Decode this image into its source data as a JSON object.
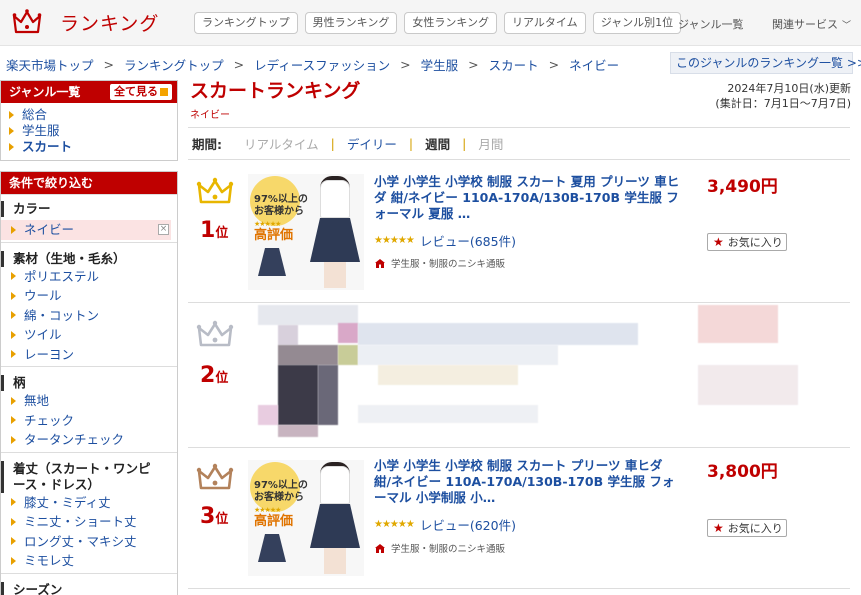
{
  "header": {
    "logo_text": "ランキング",
    "tabs": [
      "ランキングトップ",
      "男性ランキング",
      "女性ランキング",
      "リアルタイム",
      "ジャンル別1位"
    ],
    "genre_list": "ジャンル一覧",
    "related": "関連サービス"
  },
  "breadcrumb": [
    "楽天市場トップ",
    "ランキングトップ",
    "レディースファッション",
    "学生服",
    "スカート",
    "ネイビー"
  ],
  "genre_ranking_link": "このジャンルのランキング一覧 >>",
  "sidebar": {
    "genre_head": "ジャンル一覧",
    "show_all": "全て見る",
    "genres": [
      "総合",
      "学生服",
      "スカート"
    ],
    "filter_head": "条件で絞り込む",
    "groups": [
      {
        "title": "カラー",
        "items": [
          "ネイビー"
        ]
      },
      {
        "title": "素材（生地・毛糸）",
        "items": [
          "ポリエステル",
          "ウール",
          "綿・コットン",
          "ツイル",
          "レーヨン"
        ]
      },
      {
        "title": "柄",
        "items": [
          "無地",
          "チェック",
          "タータンチェック"
        ]
      },
      {
        "title": "着丈（スカート・ワンピース・ドレス）",
        "items": [
          "膝丈・ミディ丈",
          "ミニ丈・ショート丈",
          "ロング丈・マキシ丈",
          "ミモレ丈"
        ]
      },
      {
        "title": "シーズン",
        "items": []
      }
    ]
  },
  "main": {
    "title": "スカートランキング",
    "subtitle": "ネイビー",
    "updated": "2024年7月10日(水)更新",
    "period_range": "(集計日：7月1日～7月7日)",
    "period_label": "期間:",
    "periods": [
      "リアルタイム",
      "デイリー",
      "週間",
      "月間"
    ]
  },
  "items": [
    {
      "rank": "1",
      "rank_suffix": "位",
      "title": "小学 小学生 小学校 制服 スカート 夏用 プリーツ 車ヒダ 紺/ネイビー 110A-170A/130B-170B 学生服 フォーマル 夏服 …",
      "rating_text": "レビュー(685件)",
      "shop": "学生服・制服のニシキ通販",
      "price": "3,490円",
      "fav": "お気に入り",
      "promo_line1": "97%以上の",
      "promo_line2": "お客様から",
      "promo_line3": "高評価"
    },
    {
      "rank": "2",
      "rank_suffix": "位"
    },
    {
      "rank": "3",
      "rank_suffix": "位",
      "title": "小学 小学生 小学校 制服 スカート プリーツ 車ヒダ 紺/ネイビー 110A-170A/130B-170B 学生服 フォーマル 小学制服 小…",
      "rating_text": "レビュー(620件)",
      "shop": "学生服・制服のニシキ通販",
      "price": "3,800円",
      "fav": "お気に入り",
      "promo_line1": "97%以上の",
      "promo_line2": "お客様から",
      "promo_line3": "高評価"
    }
  ],
  "colors": {
    "brand": "#bf0000",
    "link": "#1d4fa0",
    "crown_gold": "#e8b600",
    "crown_silver": "#b8bcc6",
    "crown_bronze": "#b3825b"
  }
}
